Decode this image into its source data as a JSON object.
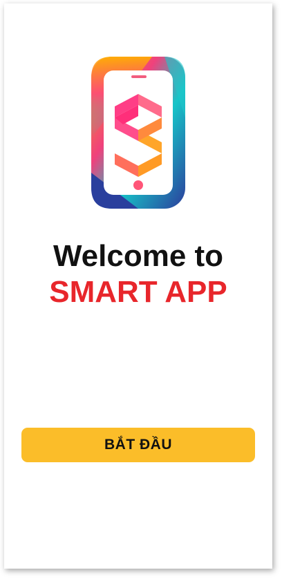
{
  "welcome": {
    "line1": "Welcome to",
    "line2": "SMART APP"
  },
  "start_button": {
    "label": "BẮT ĐẦU"
  },
  "colors": {
    "accent_red": "#e8262b",
    "button_yellow": "#fbbd29"
  },
  "logo": {
    "icon": "smartphone-s-logo-icon"
  }
}
